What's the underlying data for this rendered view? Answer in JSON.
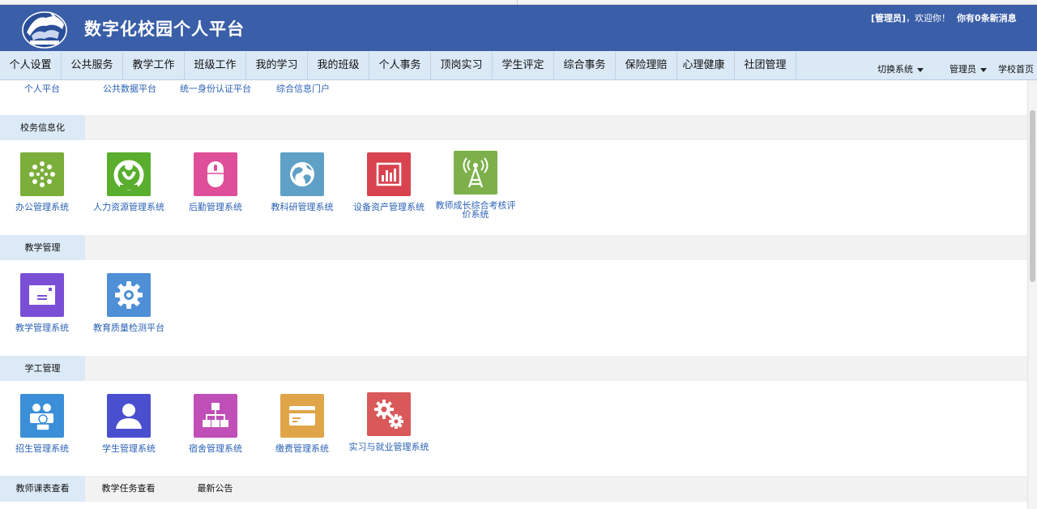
{
  "header": {
    "title": "数字化校园个人平台",
    "role": "[管理员]",
    "greeting": "，欢迎你！",
    "messages": "你有0条新消息"
  },
  "nav": {
    "items": [
      "个人设置",
      "公共服务",
      "教学工作",
      "班级工作",
      "我的学习",
      "我的班级",
      "个人事务",
      "顶岗实习",
      "学生评定",
      "综合事务",
      "保险理赔",
      "心理健康",
      "社团管理"
    ],
    "switch_system": "切换系统",
    "admin_menu": "管理员",
    "school_home": "学校首页"
  },
  "top_links": [
    "个人平台",
    "公共数据平台",
    "统一身份认证平台",
    "综合信息门户"
  ],
  "sections": [
    {
      "title": "校务信息化",
      "tiles": [
        {
          "label": "办公管理系统",
          "icon": "office-icon",
          "color": "#7bae3a"
        },
        {
          "label": "人力资源管理系统",
          "icon": "hr-icon",
          "color": "#5aae2e"
        },
        {
          "label": "后勤管理系统",
          "icon": "mouse-icon",
          "color": "#df4e98"
        },
        {
          "label": "教科研管理系统",
          "icon": "globe-icon",
          "color": "#5fa0c6"
        },
        {
          "label": "设备资产管理系统",
          "icon": "bar-chart-icon",
          "color": "#d9434f"
        },
        {
          "label": "教师成长综合考核评价系统",
          "icon": "antenna-icon",
          "color": "#7db04a"
        }
      ]
    },
    {
      "title": "教学管理",
      "tiles": [
        {
          "label": "教学管理系统",
          "icon": "card-icon",
          "color": "#7a4fd6"
        },
        {
          "label": "教育质量检测平台",
          "icon": "gear-icon",
          "color": "#4e8fd6"
        }
      ]
    },
    {
      "title": "学工管理",
      "tiles": [
        {
          "label": "招生管理系统",
          "icon": "users-icon",
          "color": "#3b8ed8"
        },
        {
          "label": "学生管理系统",
          "icon": "user-icon",
          "color": "#4a4fcf"
        },
        {
          "label": "宿舍管理系统",
          "icon": "org-chart-icon",
          "color": "#c04fb8"
        },
        {
          "label": "缴费管理系统",
          "icon": "wallet-icon",
          "color": "#e0a548"
        },
        {
          "label": "实习与就业管理系统",
          "icon": "gears-icon",
          "color": "#d9585a"
        }
      ]
    }
  ],
  "bottom_tabs": [
    "教师课表查看",
    "教学任务查看",
    "最新公告"
  ]
}
